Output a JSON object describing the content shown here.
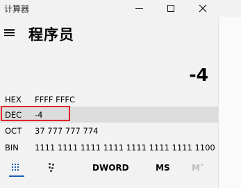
{
  "window": {
    "title": "计算器"
  },
  "header": {
    "title": "程序员"
  },
  "display": {
    "value": "-4"
  },
  "radix": [
    {
      "label": "HEX",
      "value": "FFFF FFFC"
    },
    {
      "label": "DEC",
      "value": "-4"
    },
    {
      "label": "OCT",
      "value": "37 777 777 774"
    },
    {
      "label": "BIN",
      "value": "1111 1111 1111 1111 1111 1111 1111 1100"
    }
  ],
  "toolbar": {
    "word_size": "DWORD",
    "memory_store": "MS",
    "memory_view": "M˅"
  },
  "colors": {
    "accent": "#1a5fb4",
    "selected_row": "#dcdcdc",
    "highlight_box": "#e0242a"
  }
}
